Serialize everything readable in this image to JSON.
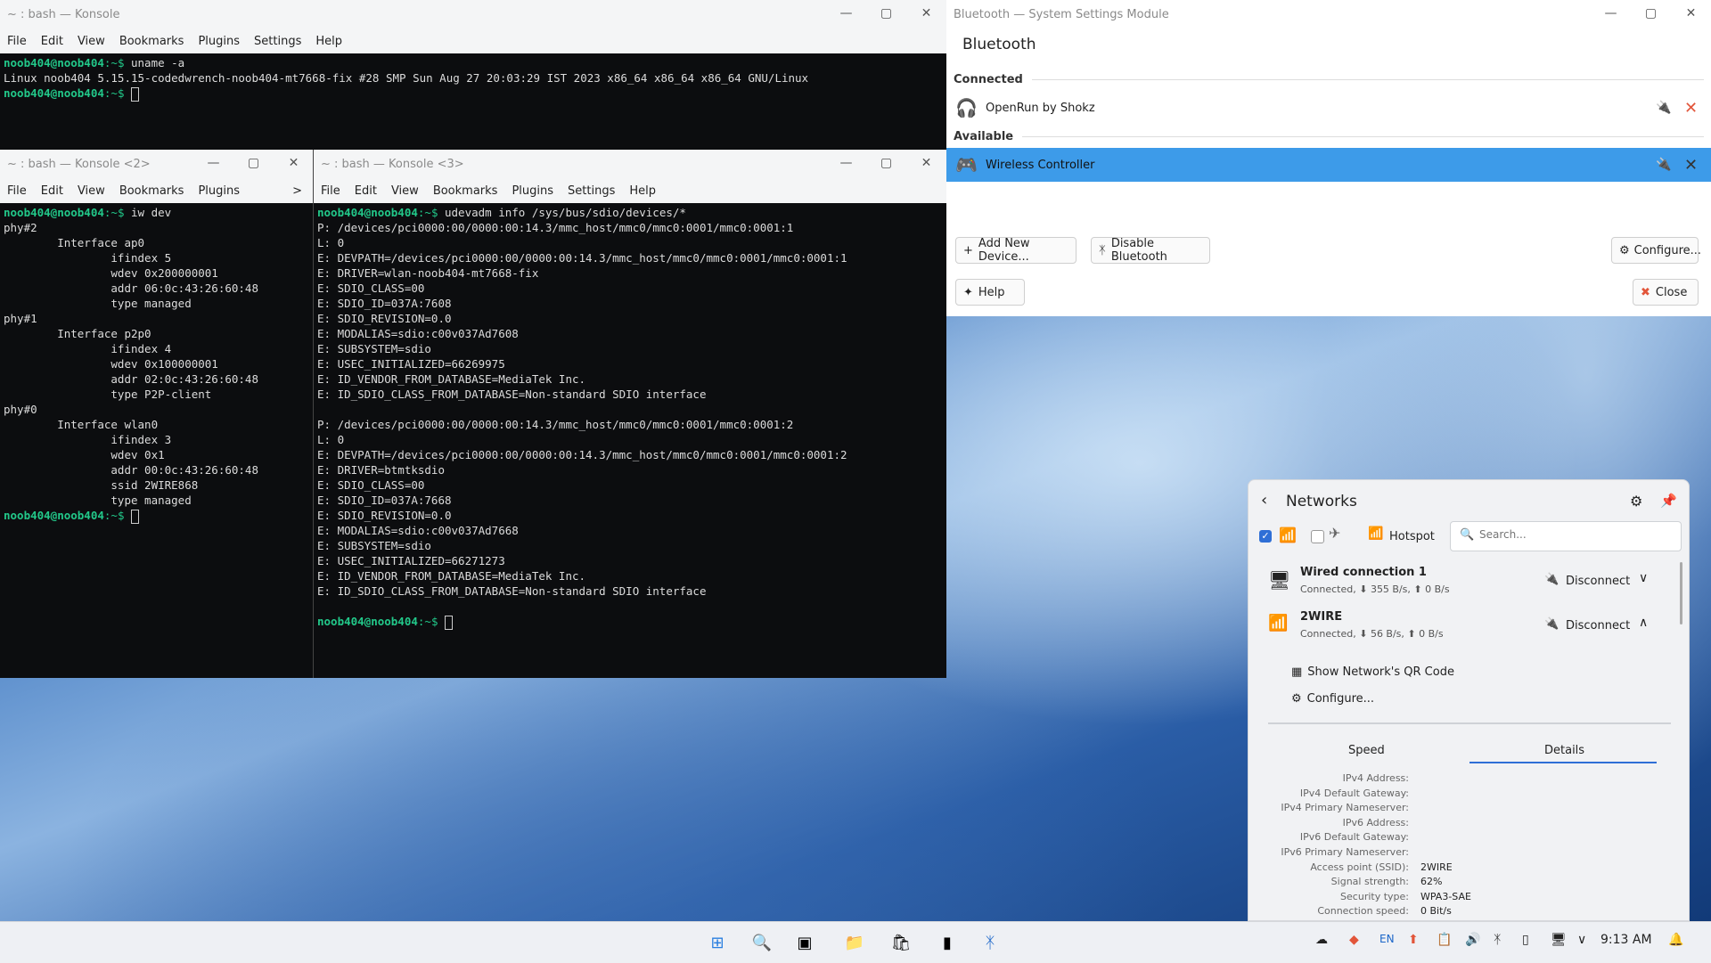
{
  "konsole1": {
    "title": "~ : bash — Konsole",
    "menu": [
      "File",
      "Edit",
      "View",
      "Bookmarks",
      "Plugins",
      "Settings",
      "Help"
    ],
    "lines": [
      {
        "prompt": "noob404@noob404",
        "path": ":~$",
        "cmd": " uname -a"
      },
      {
        "text": "Linux noob404 5.15.15-codedwrench-noob404-mt7668-fix #28 SMP Sun Aug 27 20:03:29 IST 2023 x86_64 x86_64 x86_64 GNU/Linux"
      },
      {
        "prompt": "noob404@noob404",
        "path": ":~$",
        "cmd": " ",
        "cursor": true
      }
    ]
  },
  "konsole2": {
    "title": "~ : bash — Konsole <2>",
    "menu": [
      "File",
      "Edit",
      "View",
      "Bookmarks",
      "Plugins"
    ],
    "menu_more": ">",
    "lines": [
      {
        "prompt": "noob404@noob404",
        "path": ":~$",
        "cmd": " iw dev"
      },
      {
        "text": "phy#2"
      },
      {
        "text": "        Interface ap0"
      },
      {
        "text": "                ifindex 5"
      },
      {
        "text": "                wdev 0x200000001"
      },
      {
        "text": "                addr 06:0c:43:26:60:48"
      },
      {
        "text": "                type managed"
      },
      {
        "text": "phy#1"
      },
      {
        "text": "        Interface p2p0"
      },
      {
        "text": "                ifindex 4"
      },
      {
        "text": "                wdev 0x100000001"
      },
      {
        "text": "                addr 02:0c:43:26:60:48"
      },
      {
        "text": "                type P2P-client"
      },
      {
        "text": "phy#0"
      },
      {
        "text": "        Interface wlan0"
      },
      {
        "text": "                ifindex 3"
      },
      {
        "text": "                wdev 0x1"
      },
      {
        "text": "                addr 00:0c:43:26:60:48"
      },
      {
        "text": "                ssid 2WIRE868"
      },
      {
        "text": "                type managed"
      },
      {
        "prompt": "noob404@noob404",
        "path": ":~$",
        "cmd": " ",
        "cursor": true
      }
    ]
  },
  "konsole3": {
    "title": "~ : bash — Konsole <3>",
    "menu": [
      "File",
      "Edit",
      "View",
      "Bookmarks",
      "Plugins",
      "Settings",
      "Help"
    ],
    "lines": [
      {
        "prompt": "noob404@noob404",
        "path": ":~$",
        "cmd": " udevadm info /sys/bus/sdio/devices/*"
      },
      {
        "text": "P: /devices/pci0000:00/0000:00:14.3/mmc_host/mmc0/mmc0:0001/mmc0:0001:1"
      },
      {
        "text": "L: 0"
      },
      {
        "text": "E: DEVPATH=/devices/pci0000:00/0000:00:14.3/mmc_host/mmc0/mmc0:0001/mmc0:0001:1"
      },
      {
        "text": "E: DRIVER=wlan-noob404-mt7668-fix"
      },
      {
        "text": "E: SDIO_CLASS=00"
      },
      {
        "text": "E: SDIO_ID=037A:7608"
      },
      {
        "text": "E: SDIO_REVISION=0.0"
      },
      {
        "text": "E: MODALIAS=sdio:c00v037Ad7608"
      },
      {
        "text": "E: SUBSYSTEM=sdio"
      },
      {
        "text": "E: USEC_INITIALIZED=66269975"
      },
      {
        "text": "E: ID_VENDOR_FROM_DATABASE=MediaTek Inc."
      },
      {
        "text": "E: ID_SDIO_CLASS_FROM_DATABASE=Non-standard SDIO interface"
      },
      {
        "text": ""
      },
      {
        "text": "P: /devices/pci0000:00/0000:00:14.3/mmc_host/mmc0/mmc0:0001/mmc0:0001:2"
      },
      {
        "text": "L: 0"
      },
      {
        "text": "E: DEVPATH=/devices/pci0000:00/0000:00:14.3/mmc_host/mmc0/mmc0:0001/mmc0:0001:2"
      },
      {
        "text": "E: DRIVER=btmtksdio"
      },
      {
        "text": "E: SDIO_CLASS=00"
      },
      {
        "text": "E: SDIO_ID=037A:7668"
      },
      {
        "text": "E: SDIO_REVISION=0.0"
      },
      {
        "text": "E: MODALIAS=sdio:c00v037Ad7668"
      },
      {
        "text": "E: SUBSYSTEM=sdio"
      },
      {
        "text": "E: USEC_INITIALIZED=66271273"
      },
      {
        "text": "E: ID_VENDOR_FROM_DATABASE=MediaTek Inc."
      },
      {
        "text": "E: ID_SDIO_CLASS_FROM_DATABASE=Non-standard SDIO interface"
      },
      {
        "text": ""
      },
      {
        "prompt": "noob404@noob404",
        "path": ":~$",
        "cmd": " ",
        "cursor": true
      }
    ]
  },
  "bluetooth": {
    "window_title": "Bluetooth — System Settings Module",
    "heading": "Bluetooth",
    "connected_label": "Connected",
    "available_label": "Available",
    "connected_device": "OpenRun by Shokz",
    "available_device": "Wireless Controller",
    "add_device": "Add New Device...",
    "disable": "Disable Bluetooth",
    "configure": "Configure...",
    "help": "Help",
    "close": "Close"
  },
  "networks": {
    "title": "Networks",
    "hotspot": "Hotspot",
    "search_placeholder": "Search...",
    "wired_name": "Wired connection 1",
    "wired_status": "Connected, ⬇ 355 B/s, ⬆ 0 B/s",
    "wifi_name": "2WIRE",
    "wifi_status": "Connected, ⬇ 56 B/s, ⬆ 0 B/s",
    "disconnect": "Disconnect",
    "qr": "Show Network's QR Code",
    "configure": "Configure...",
    "tab_speed": "Speed",
    "tab_details": "Details",
    "details": [
      {
        "label": "IPv4 Address:",
        "value": ""
      },
      {
        "label": "IPv4 Default Gateway:",
        "value": ""
      },
      {
        "label": "IPv4 Primary Nameserver:",
        "value": ""
      },
      {
        "label": "IPv6 Address:",
        "value": ""
      },
      {
        "label": "IPv6 Default Gateway:",
        "value": ""
      },
      {
        "label": "IPv6 Primary Nameserver:",
        "value": ""
      },
      {
        "label": "Access point (SSID):",
        "value": "2WIRE"
      },
      {
        "label": "Signal strength:",
        "value": "62%"
      },
      {
        "label": "Security type:",
        "value": "WPA3-SAE"
      },
      {
        "label": "Connection speed:",
        "value": "0 Bit/s"
      }
    ]
  },
  "taskbar": {
    "lang": "EN",
    "clock": "9:13 AM"
  },
  "colors": {
    "accent": "#3d9be9",
    "prompt": "#22c98a",
    "close_red": "#e2553a"
  }
}
